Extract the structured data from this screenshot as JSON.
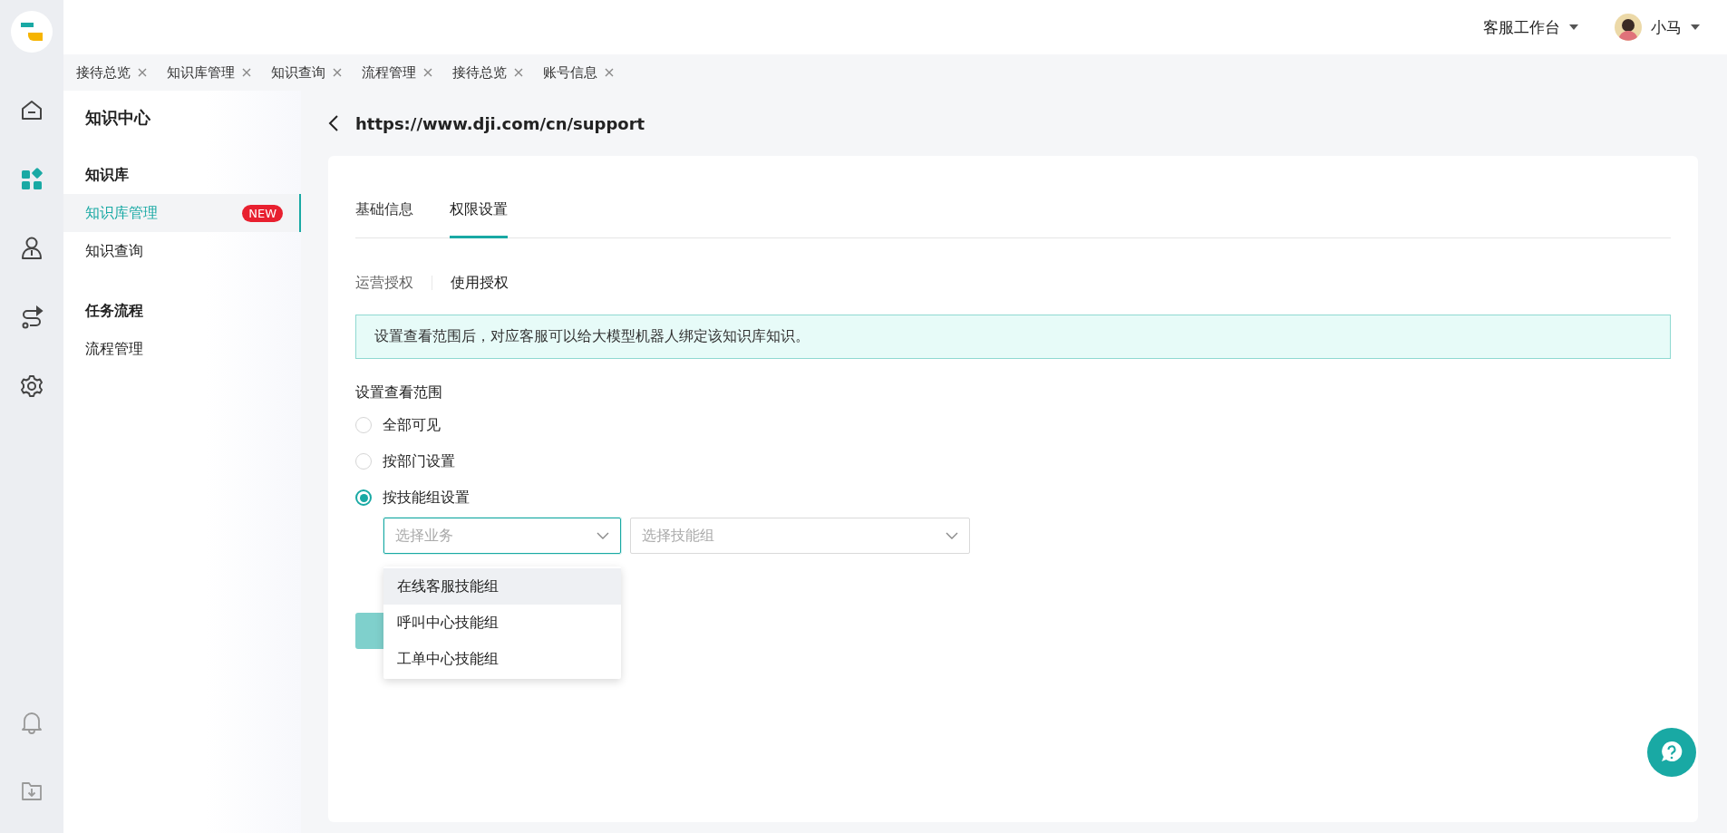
{
  "app_rail": {
    "items": [
      {
        "kind": "home",
        "selected": false
      },
      {
        "kind": "apps",
        "selected": true
      },
      {
        "kind": "person",
        "selected": false
      },
      {
        "kind": "flow",
        "selected": false
      },
      {
        "kind": "settings",
        "selected": false
      }
    ],
    "bottom": [
      {
        "kind": "bell"
      },
      {
        "kind": "download"
      }
    ]
  },
  "header": {
    "workspace": "客服工作台",
    "user": "小马"
  },
  "tabs": [
    {
      "label": "接待总览"
    },
    {
      "label": "知识库管理"
    },
    {
      "label": "知识查询"
    },
    {
      "label": "流程管理"
    },
    {
      "label": "接待总览"
    },
    {
      "label": "账号信息"
    }
  ],
  "sidebar": {
    "title": "知识中心",
    "sections": [
      {
        "heading": "知识库",
        "items": [
          {
            "label": "知识库管理",
            "selected": true,
            "badge": "NEW"
          },
          {
            "label": "知识查询",
            "selected": false
          }
        ]
      },
      {
        "heading": "任务流程",
        "items": [
          {
            "label": "流程管理",
            "selected": false
          }
        ]
      }
    ]
  },
  "page": {
    "url": "https://www.dji.com/cn/support",
    "tabs": [
      {
        "label": "基础信息",
        "selected": false
      },
      {
        "label": "权限设置",
        "selected": true
      }
    ],
    "sub_tabs": [
      {
        "label": "运营授权",
        "selected": false
      },
      {
        "label": "使用授权",
        "selected": true
      }
    ],
    "notice": "设置查看范围后，对应客服可以给大模型机器人绑定该知识库知识。",
    "scope_label": "设置查看范围",
    "scope_options": [
      {
        "label": "全部可见",
        "selected": false
      },
      {
        "label": "按部门设置",
        "selected": false
      },
      {
        "label": "按技能组设置",
        "selected": true
      }
    ],
    "business_select": {
      "placeholder": "选择业务",
      "focused": true
    },
    "group_select": {
      "placeholder": "选择技能组",
      "focused": false
    },
    "business_options": [
      {
        "label": "在线客服技能组",
        "highlighted": true
      },
      {
        "label": "呼叫中心技能组",
        "highlighted": false
      },
      {
        "label": "工单中心技能组",
        "highlighted": false
      }
    ]
  }
}
